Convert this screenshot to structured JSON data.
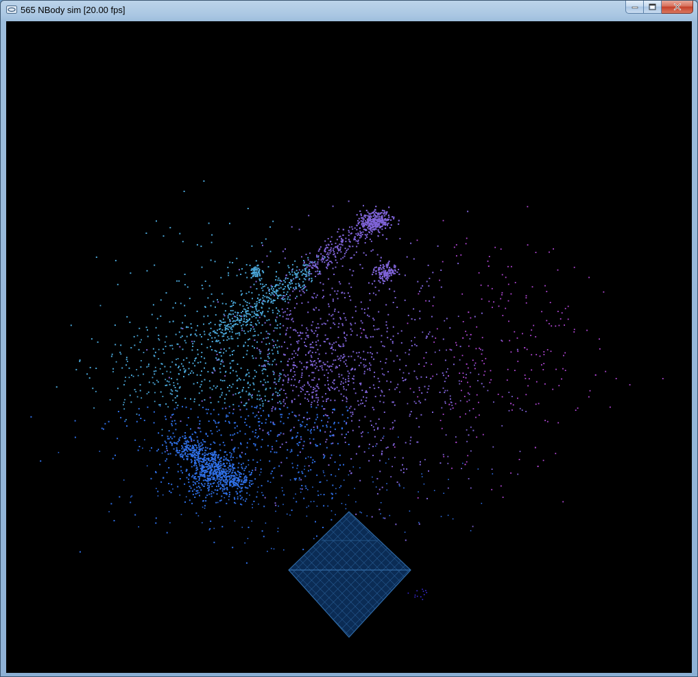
{
  "window": {
    "title": "565 NBody sim [20.00 fps]",
    "app_icon": "window-app-icon",
    "controls": {
      "minimize_icon": "minimize-icon",
      "maximize_icon": "maximize-icon",
      "close_icon": "close-icon"
    }
  },
  "simulation": {
    "background_color": "#000000",
    "particle_colors": {
      "blue": "#2f6fe6",
      "light_blue": "#4aa6d8",
      "violet": "#7f63d8",
      "magenta": "#b247d6"
    },
    "grid_overlay_color": "#1c4f86"
  }
}
